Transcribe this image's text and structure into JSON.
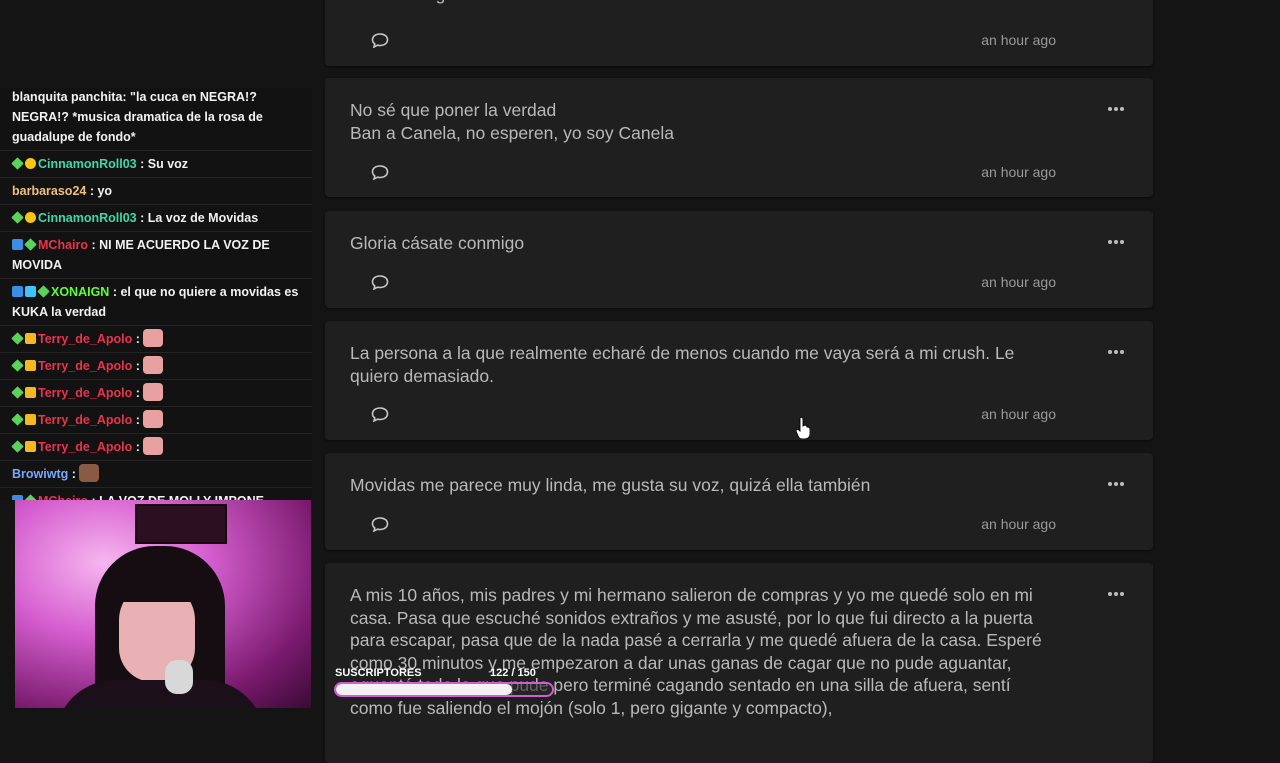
{
  "chat": {
    "messages": [
      {
        "name": "",
        "name_color": "#f2f2f2",
        "badges": [],
        "text": "blanquita panchita: \"la cuca en NEGRA!? NEGRA!? *musica dramatica de la rosa de guadalupe de fondo*",
        "emote": ""
      },
      {
        "name": "CinnamonRoll03",
        "name_color": "#3fd9a8",
        "badges": [
          "diamond",
          "coin"
        ],
        "text": ": Su voz",
        "emote": ""
      },
      {
        "name": "barbaraso24",
        "name_color": "#f0c080",
        "badges": [],
        "text": ": yo",
        "emote": ""
      },
      {
        "name": "CinnamonRoll03",
        "name_color": "#3fd9a8",
        "badges": [
          "diamond",
          "coin"
        ],
        "text": ": La voz de Movidas",
        "emote": ""
      },
      {
        "name": "MChairo",
        "name_color": "#e8344e",
        "badges": [
          "sub",
          "diamond"
        ],
        "text": ": NI ME ACUERDO LA VOZ DE MOVIDA",
        "emote": ""
      },
      {
        "name": "XONAIGN",
        "name_color": "#5dff3a",
        "badges": [
          "sub",
          "cube",
          "diamond"
        ],
        "text": ": el que no quiere a movidas es KUKA la verdad",
        "emote": ""
      },
      {
        "name": "Terry_de_Apolo",
        "name_color": "#e8344e",
        "badges": [
          "diamond",
          "crown"
        ],
        "text": ":",
        "emote": "pink"
      },
      {
        "name": "Terry_de_Apolo",
        "name_color": "#e8344e",
        "badges": [
          "diamond",
          "crown"
        ],
        "text": ":",
        "emote": "pink"
      },
      {
        "name": "Terry_de_Apolo",
        "name_color": "#e8344e",
        "badges": [
          "diamond",
          "crown"
        ],
        "text": ":",
        "emote": "pink"
      },
      {
        "name": "Terry_de_Apolo",
        "name_color": "#e8344e",
        "badges": [
          "diamond",
          "crown"
        ],
        "text": ":",
        "emote": "pink"
      },
      {
        "name": "Terry_de_Apolo",
        "name_color": "#e8344e",
        "badges": [
          "diamond",
          "crown"
        ],
        "text": ":",
        "emote": "pink"
      },
      {
        "name": "Browiwtg",
        "name_color": "#7aa8ff",
        "badges": [],
        "text": ":",
        "emote": "brown"
      },
      {
        "name": "MChairo",
        "name_color": "#e8344e",
        "badges": [
          "sub",
          "diamond"
        ],
        "text": ": LA VOZ DE MOLLY IMPONE RESPETO, YO LE TENGO MIEDO",
        "emote": ""
      }
    ]
  },
  "feed": {
    "cards": [
      {
        "text": "de mi en algunos años",
        "time": "an hour ago"
      },
      {
        "text": "No sé que poner la verdad\nBan a Canela, no esperen, yo soy Canela",
        "time": "an hour ago"
      },
      {
        "text": "Gloria cásate conmigo",
        "time": "an hour ago"
      },
      {
        "text": "La persona a la que realmente echaré de menos cuando me vaya será a mi crush. Le quiero demasiado.",
        "time": "an hour ago"
      },
      {
        "text": "Movidas me parece muy linda, me gusta su voz, quizá ella también",
        "time": "an hour ago"
      },
      {
        "text": "A mis 10 años, mis padres y mi hermano salieron de compras y yo me quedé solo en mi casa. Pasa que escuché sonidos extraños y me asusté, por lo que fui directo a la puerta para escapar, pasa que de la nada pasé a cerrarla y me quedé afuera de la casa. Esperé como 30 minutos y me empezaron a dar unas ganas de cagar que no pude aguantar, aguanté todo lo que pude pero terminé cagando sentado en una silla de afuera, sentí como fue saliendo el mojón (solo 1, pero gigante y compacto),",
        "time": ""
      }
    ]
  },
  "subs": {
    "label": "SUSCRIPTORES",
    "count": "122 / 150",
    "progress": 0.813
  }
}
